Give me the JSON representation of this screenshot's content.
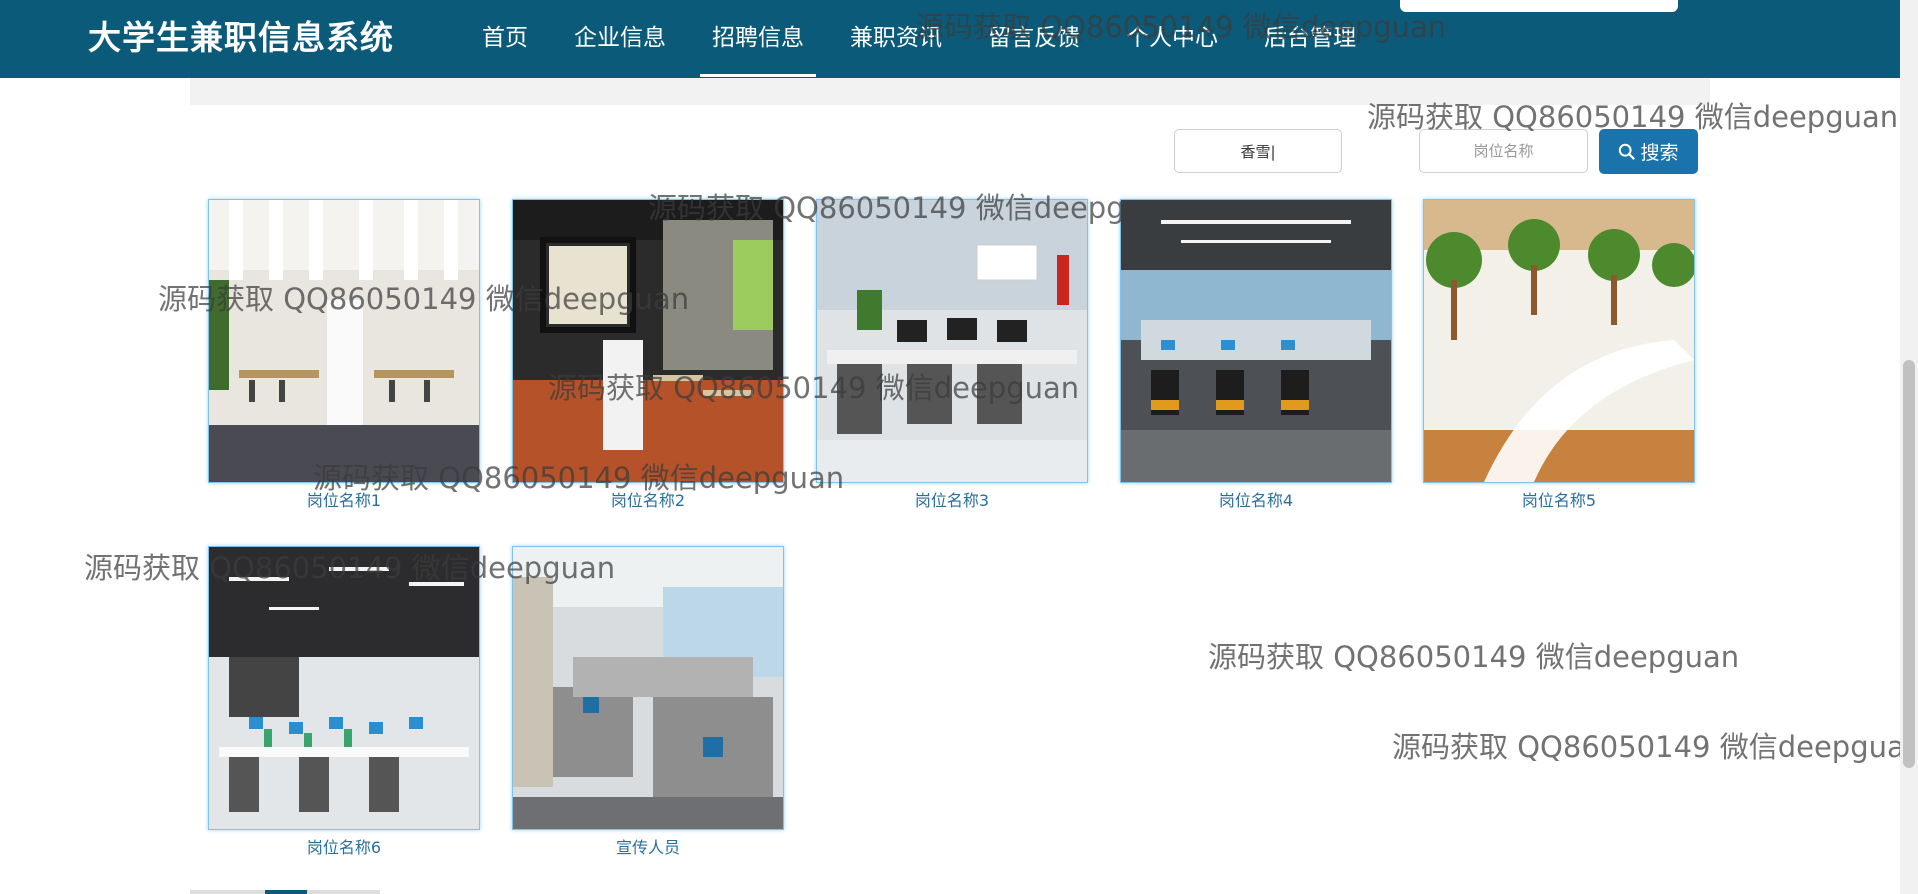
{
  "app_title": "大学生兼职信息系统",
  "nav": [
    {
      "label": "首页",
      "active": false
    },
    {
      "label": "企业信息",
      "active": false
    },
    {
      "label": "招聘信息",
      "active": true
    },
    {
      "label": "兼职资讯",
      "active": false
    },
    {
      "label": "留言反馈",
      "active": false
    },
    {
      "label": "个人中心",
      "active": false
    },
    {
      "label": "后台管理",
      "active": false
    }
  ],
  "search": {
    "company_value": "香雪|",
    "position_placeholder": "岗位名称",
    "button_label": "搜索"
  },
  "jobs": [
    {
      "caption": "岗位名称1"
    },
    {
      "caption": "岗位名称2"
    },
    {
      "caption": "岗位名称3"
    },
    {
      "caption": "岗位名称4"
    },
    {
      "caption": "岗位名称5"
    },
    {
      "caption": "岗位名称6"
    },
    {
      "caption": "宣传人员"
    }
  ],
  "watermark": "源码获取 QQ86050149 微信deepguan",
  "colors": {
    "header": "#0b5a7a",
    "accent_button": "#1a74ab",
    "caption": "#2a6f9b"
  }
}
